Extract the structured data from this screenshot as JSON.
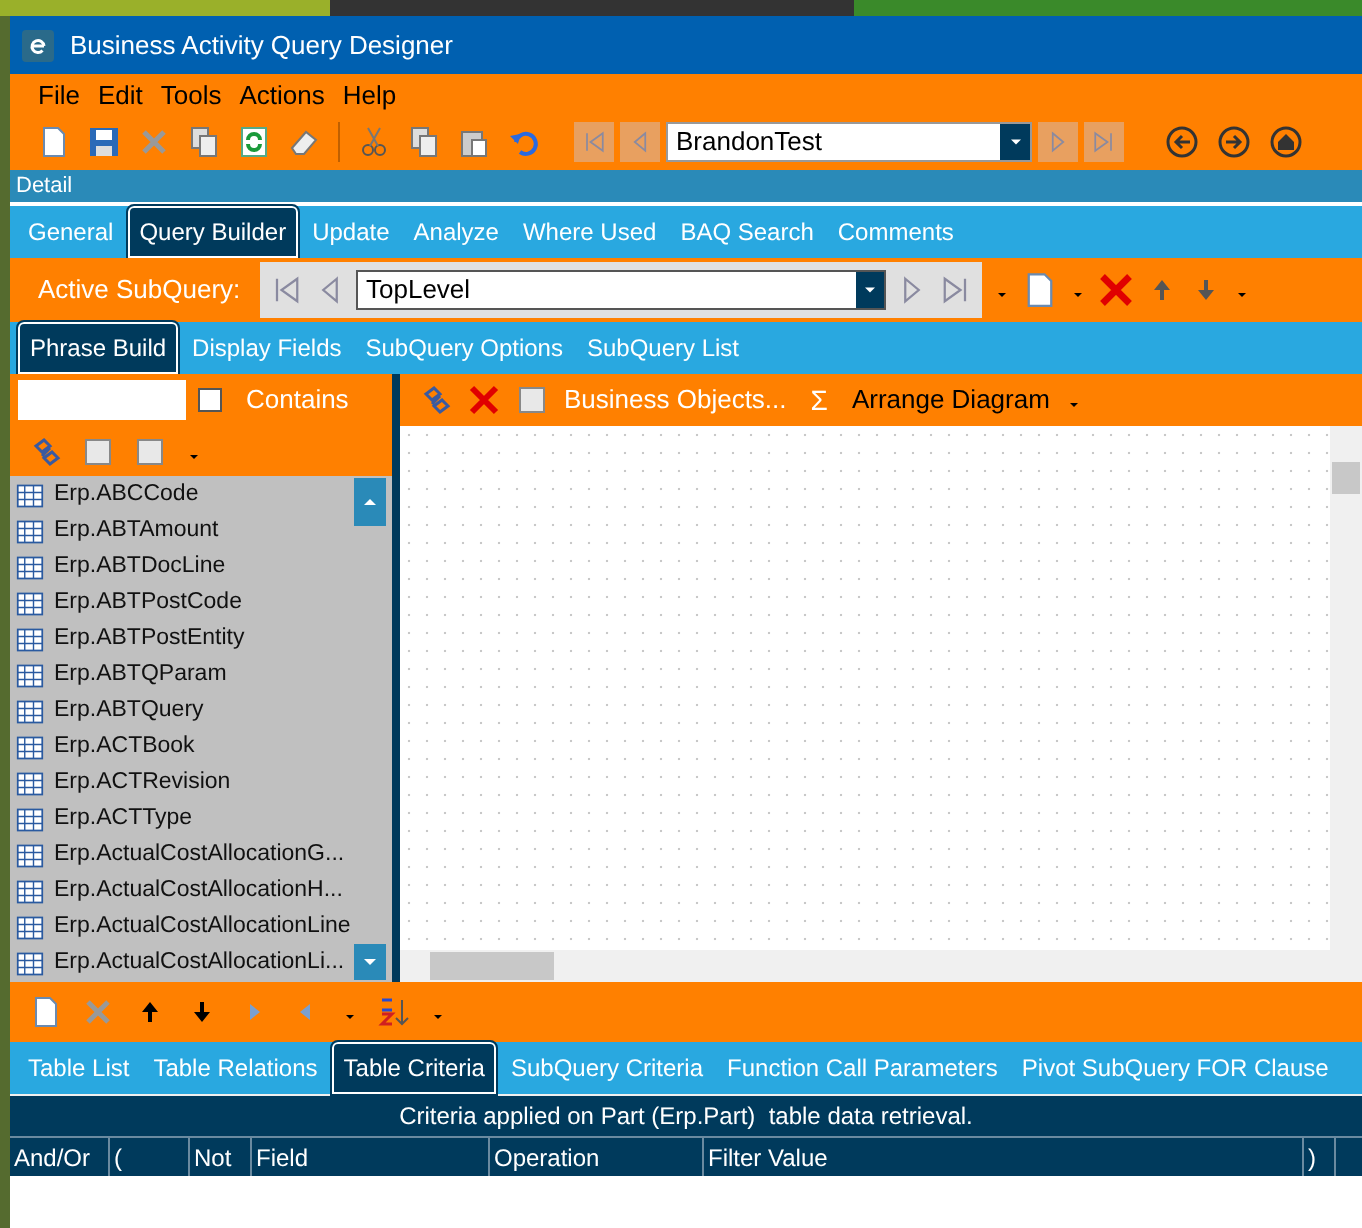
{
  "window": {
    "title": "Business Activity Query Designer"
  },
  "menu": [
    "File",
    "Edit",
    "Tools",
    "Actions",
    "Help"
  ],
  "toolbar": {
    "record": "BrandonTest"
  },
  "section_label": "Detail",
  "tabs": [
    {
      "label": "General",
      "selected": false
    },
    {
      "label": "Query Builder",
      "selected": true
    },
    {
      "label": "Update",
      "selected": false
    },
    {
      "label": "Analyze",
      "selected": false
    },
    {
      "label": "Where Used",
      "selected": false
    },
    {
      "label": "BAQ Search",
      "selected": false
    },
    {
      "label": "Comments",
      "selected": false
    }
  ],
  "subquery": {
    "label": "Active SubQuery:",
    "value": "TopLevel"
  },
  "subtabs": [
    {
      "label": "Phrase Build",
      "selected": true
    },
    {
      "label": "Display Fields",
      "selected": false
    },
    {
      "label": "SubQuery Options",
      "selected": false
    },
    {
      "label": "SubQuery List",
      "selected": false
    }
  ],
  "filter": {
    "contains_label": "Contains",
    "checked": false
  },
  "canvas_toolbar": {
    "business_objects": "Business Objects...",
    "sigma": "Σ",
    "arrange": "Arrange Diagram"
  },
  "tables": [
    "Erp.ABCCode",
    "Erp.ABTAmount",
    "Erp.ABTDocLine",
    "Erp.ABTPostCode",
    "Erp.ABTPostEntity",
    "Erp.ABTQParam",
    "Erp.ABTQuery",
    "Erp.ACTBook",
    "Erp.ACTRevision",
    "Erp.ACTType",
    "Erp.ActualCostAllocationG...",
    "Erp.ActualCostAllocationH...",
    "Erp.ActualCostAllocationLine",
    "Erp.ActualCostAllocationLi..."
  ],
  "bottom_tabs": [
    {
      "label": "Table List",
      "selected": false
    },
    {
      "label": "Table Relations",
      "selected": false
    },
    {
      "label": "Table Criteria",
      "selected": true
    },
    {
      "label": "SubQuery Criteria",
      "selected": false
    },
    {
      "label": "Function Call Parameters",
      "selected": false
    },
    {
      "label": "Pivot SubQuery FOR Clause",
      "selected": false
    }
  ],
  "criteria": {
    "caption": "Criteria applied on Part (Erp.Part)  table data retrieval.",
    "columns": [
      "And/Or",
      "(",
      "Not",
      "Field",
      "Operation",
      "Filter Value",
      ")"
    ]
  }
}
